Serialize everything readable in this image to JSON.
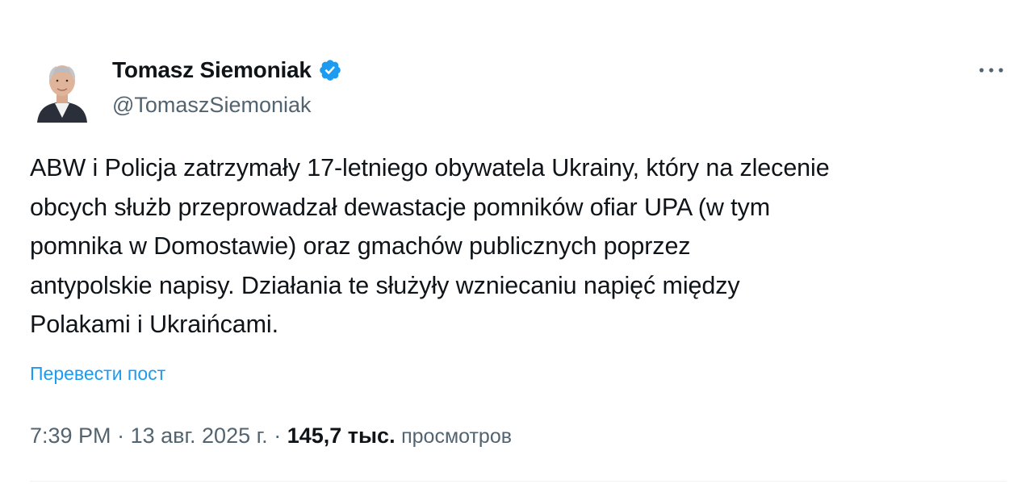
{
  "author": {
    "display_name": "Tomasz Siemoniak",
    "handle": "@TomaszSiemoniak",
    "verified": true
  },
  "tweet": {
    "text": "ABW i Policja zatrzymały 17-letniego obywatela Ukrainy, który na zlecenie\nobcych służb przeprowadzał dewastacje pomników ofiar UPA (w tym\npomnika w Domostawie) oraz gmachów publicznych poprzez\nantypolskie napisy. Działania te służyły wzniecaniu napięć między\nPolakami i Ukraińcami.",
    "translate_label": "Перевести пост",
    "time": "7:39 PM",
    "separator": "·",
    "date": "13 авг. 2025 г.",
    "views_count": "145,7 тыс.",
    "views_label": "просмотров"
  },
  "icons": {
    "verified": "verified-badge-icon",
    "more": "more-options-icon"
  },
  "colors": {
    "accent": "#1d9bf0",
    "text_primary": "#0f1419",
    "text_secondary": "#536471"
  }
}
